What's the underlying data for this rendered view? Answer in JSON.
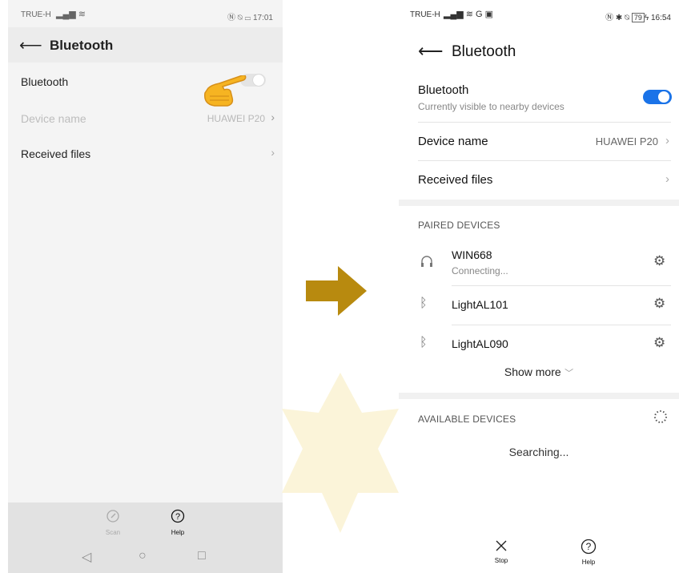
{
  "left_screen": {
    "status": {
      "carrier": "TRUE-H",
      "time": "17:01",
      "signal_icons": "signal-wifi",
      "right_icons": "NFC-DND-battery"
    },
    "header": {
      "title": "Bluetooth",
      "back_icon": "back-arrow-icon"
    },
    "rows": [
      {
        "label": "Bluetooth",
        "toggle_on": false
      },
      {
        "label": "Device name",
        "value": "HUAWEI P20"
      },
      {
        "label": "Received files"
      }
    ],
    "pointer_icon": "pointing-hand-emoji",
    "bottom_tabs": [
      {
        "label": "Scan",
        "icon": "scan-icon"
      },
      {
        "label": "Help",
        "icon": "help-icon"
      }
    ]
  },
  "arrow_color": "#b88a0f",
  "right_screen": {
    "status": {
      "carrier": "TRUE-H",
      "time": "16:54",
      "battery": "79",
      "signal_icons": "signal-wifi-G",
      "right_icons": "NFC-bluetooth-DND-battery"
    },
    "header": {
      "title": "Bluetooth",
      "back_icon": "back-arrow-icon"
    },
    "bluetooth_row": {
      "label": "Bluetooth",
      "sub": "Currently visible to nearby devices",
      "toggle_on": true
    },
    "device_name_row": {
      "label": "Device name",
      "value": "HUAWEI P20"
    },
    "received_files_row": {
      "label": "Received files"
    },
    "paired": {
      "title": "PAIRED DEVICES",
      "devices": [
        {
          "name": "WIN668",
          "status": "Connecting...",
          "icon": "headphones-icon"
        },
        {
          "name": "LightAL101",
          "icon": "bluetooth-icon"
        },
        {
          "name": "LightAL090",
          "icon": "bluetooth-icon"
        }
      ],
      "show_more": "Show more"
    },
    "available": {
      "title": "AVAILABLE DEVICES",
      "searching": "Searching..."
    },
    "bottom_tabs": [
      {
        "label": "Stop",
        "icon": "close-icon"
      },
      {
        "label": "Help",
        "icon": "help-icon"
      }
    ],
    "accent_color": "#1a73e8"
  }
}
